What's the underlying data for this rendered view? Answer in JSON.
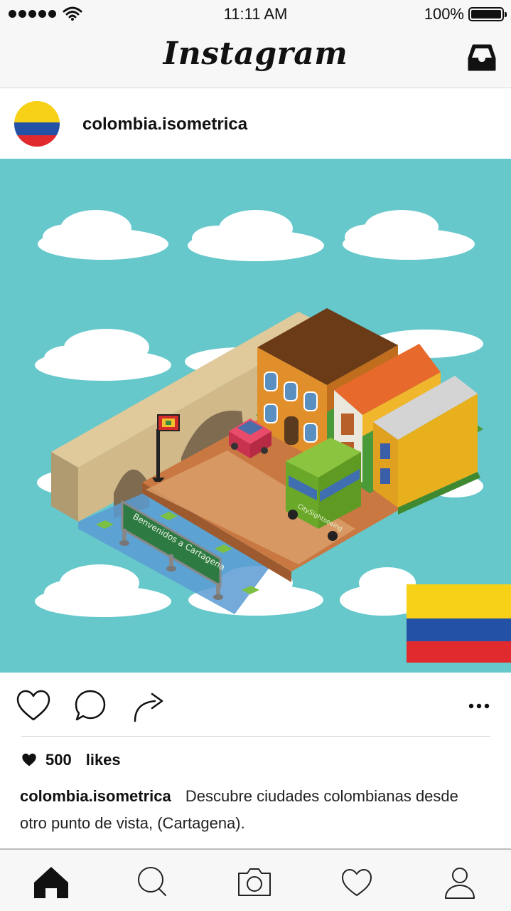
{
  "status_bar": {
    "time": "11:11 AM",
    "battery_percent": "100%",
    "signal_bars": 5,
    "icons": [
      "signal-dots",
      "wifi-icon",
      "battery-icon"
    ]
  },
  "header": {
    "title": "Instagram",
    "inbox_icon": "inbox-icon"
  },
  "post": {
    "username": "colombia.isometrica",
    "avatar": "colombia-flag-avatar",
    "image_sign_text": "Benvenidos a Cartagena",
    "image_bus_text": "CitySightseeing",
    "likes_count": "500",
    "likes_word": "likes",
    "caption_user": "colombia.isometrica",
    "caption_text": "Descubre ciudades colombianas desde otro punto de vista, (Cartagena).",
    "action_icons": [
      "heart-icon",
      "comment-icon",
      "share-icon",
      "more-icon"
    ]
  },
  "tab_bar": {
    "tabs": [
      "home-icon",
      "search-icon",
      "camera-icon",
      "heart-icon",
      "profile-icon"
    ],
    "active": "home-icon"
  },
  "colors": {
    "sky": "#66c8cb",
    "flag_yellow": "#f7d117",
    "flag_blue": "#2351a6",
    "flag_red": "#e02a2e",
    "bar_background": "#f7f7f7"
  }
}
